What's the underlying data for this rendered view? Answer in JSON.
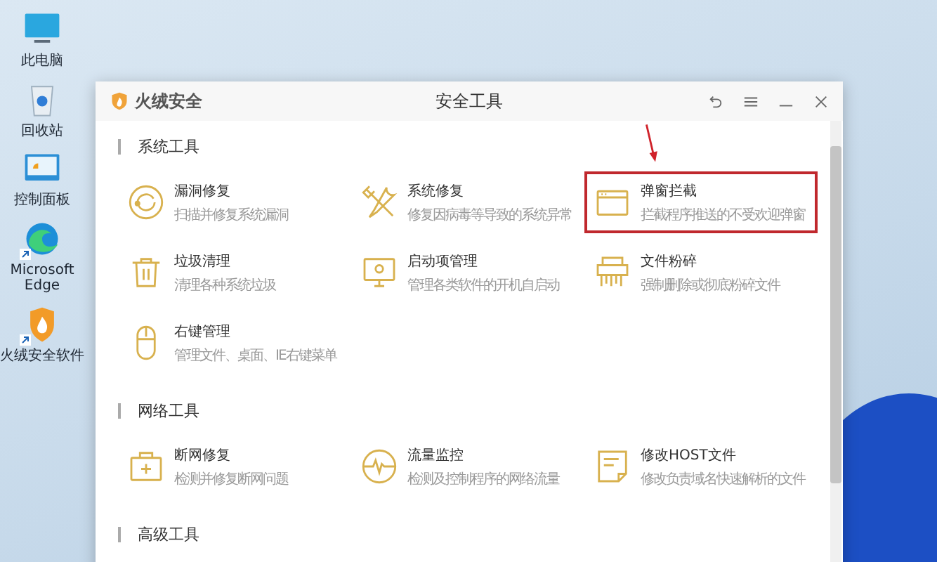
{
  "desktop_icons": [
    {
      "label": "此电脑"
    },
    {
      "label": "回收站"
    },
    {
      "label": "控制面板"
    },
    {
      "label": "Microsoft Edge",
      "shortcut": true
    },
    {
      "label": "火绒安全软件",
      "shortcut": true
    }
  ],
  "window": {
    "app_name": "火绒安全",
    "title": "安全工具"
  },
  "sections": [
    {
      "title": "系统工具",
      "items": [
        {
          "name": "漏洞修复",
          "desc": "扫描并修复系统漏洞",
          "highlighted": false
        },
        {
          "name": "系统修复",
          "desc": "修复因病毒等导致的系统异常",
          "highlighted": false
        },
        {
          "name": "弹窗拦截",
          "desc": "拦截程序推送的不受欢迎弹窗",
          "highlighted": true
        },
        {
          "name": "垃圾清理",
          "desc": "清理各种系统垃圾",
          "highlighted": false
        },
        {
          "name": "启动项管理",
          "desc": "管理各类软件的开机自启动",
          "highlighted": false
        },
        {
          "name": "文件粉碎",
          "desc": "强制删除或彻底粉碎文件",
          "highlighted": false
        },
        {
          "name": "右键管理",
          "desc": "管理文件、桌面、IE右键菜单",
          "highlighted": false
        }
      ]
    },
    {
      "title": "网络工具",
      "items": [
        {
          "name": "断网修复",
          "desc": "检测并修复断网问题",
          "highlighted": false
        },
        {
          "name": "流量监控",
          "desc": "检测及控制程序的网络流量",
          "highlighted": false
        },
        {
          "name": "修改HOST文件",
          "desc": "修改负责域名快速解析的文件",
          "highlighted": false
        }
      ]
    },
    {
      "title": "高级工具"
    }
  ]
}
